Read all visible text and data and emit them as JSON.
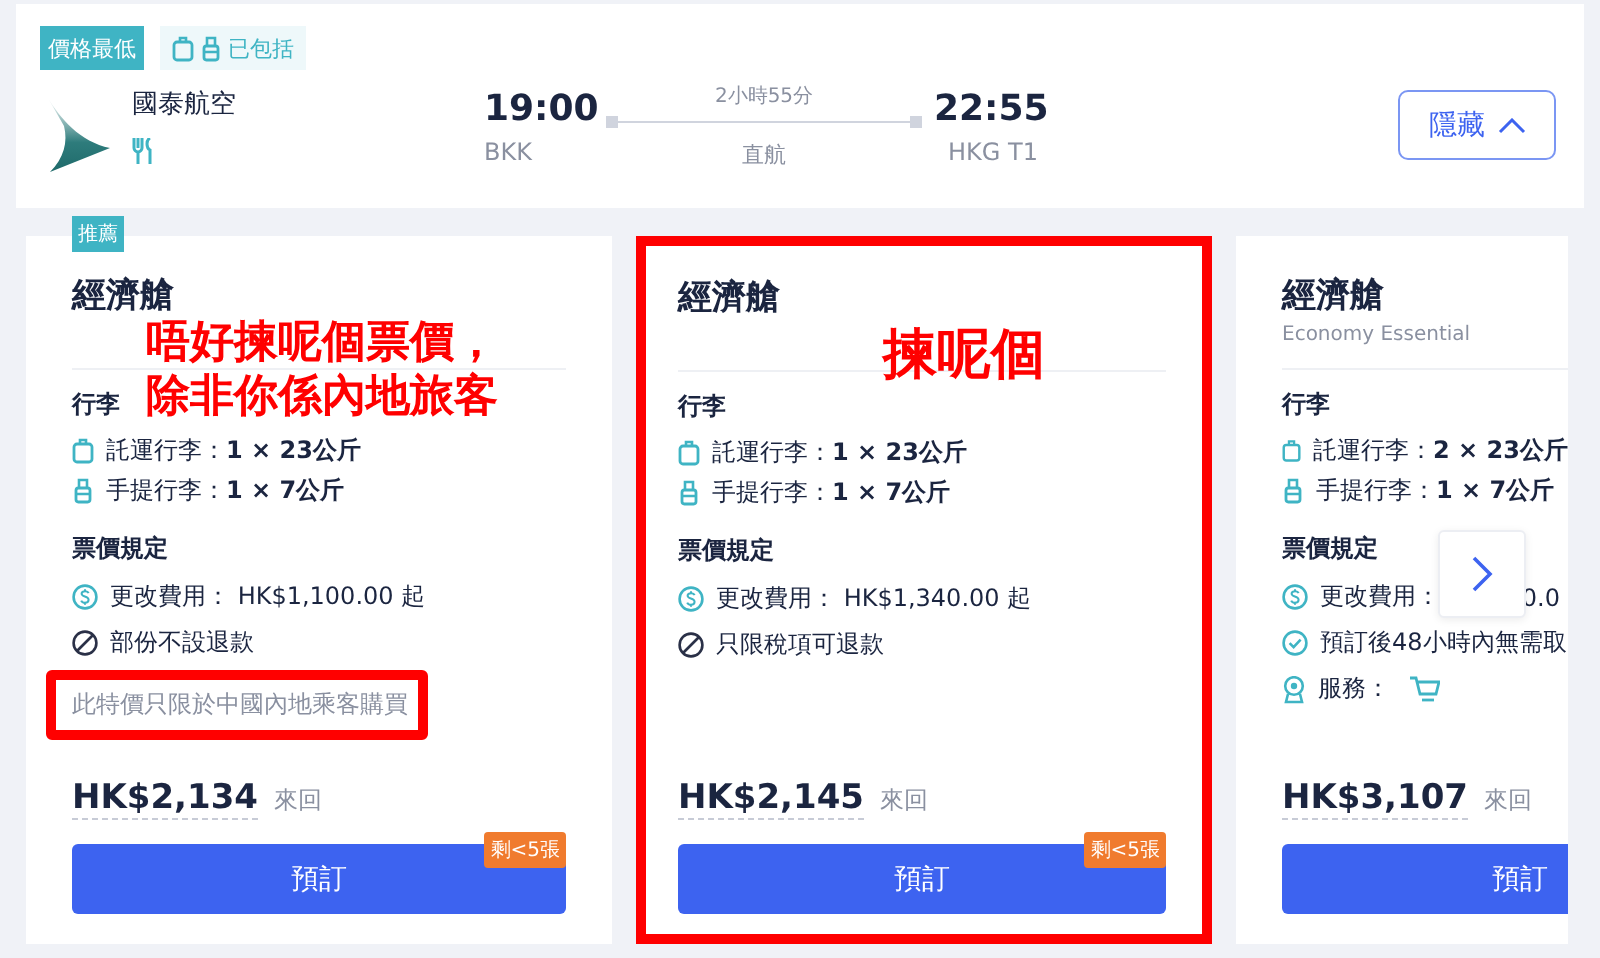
{
  "flight": {
    "badges": [
      {
        "kind": "best",
        "text": "價格最低"
      },
      {
        "kind": "baggage",
        "text": "已包括"
      }
    ],
    "airline": "國泰航空",
    "depart": {
      "time": "19:00",
      "airport": "BKK"
    },
    "duration": "2小時55分",
    "stops": "直航",
    "arrive": {
      "time": "22:55",
      "airport": "HKG T1"
    },
    "toggle": "隱藏"
  },
  "fares": [
    {
      "tag": "推薦",
      "title": "經濟艙",
      "boxed": false,
      "annotation": [
        "唔好揀呢個票價，",
        "除非你係內地旅客"
      ],
      "baggage_title": "行李",
      "baggage": [
        {
          "kind": "checked",
          "label": "託運行李：",
          "value": "1 × 23公斤"
        },
        {
          "kind": "cabin",
          "label": "手提行李：",
          "value": "1 × 7公斤"
        }
      ],
      "rules_title": "票價規定",
      "rules": [
        {
          "kind": "fee",
          "text": "更改費用： HK$1,100.00 起"
        },
        {
          "kind": "refund",
          "text": "部份不設退款"
        }
      ],
      "note": {
        "text": "此特價只限於中國內地乘客購買",
        "highlighted": true
      },
      "price": "HK$2,134",
      "trip": "來回",
      "book": "預訂",
      "seats": "剩<5張"
    },
    {
      "title": "經濟艙",
      "boxed": true,
      "annotation": [
        "揀呢個"
      ],
      "baggage_title": "行李",
      "baggage": [
        {
          "kind": "checked",
          "label": "託運行李：",
          "value": "1 × 23公斤"
        },
        {
          "kind": "cabin",
          "label": "手提行李：",
          "value": "1 × 7公斤"
        }
      ],
      "rules_title": "票價規定",
      "rules": [
        {
          "kind": "fee",
          "text": "更改費用： HK$1,340.00 起"
        },
        {
          "kind": "refund",
          "text": "只限稅項可退款"
        }
      ],
      "price": "HK$2,145",
      "trip": "來回",
      "book": "預訂",
      "seats": "剩<5張"
    },
    {
      "title": "經濟艙",
      "subtitle": "Economy Essential",
      "boxed": false,
      "baggage_title": "行李",
      "baggage": [
        {
          "kind": "checked",
          "label": "託運行李：",
          "value": "2 × 23公斤"
        },
        {
          "kind": "cabin",
          "label": "手提行李：",
          "value": "1 × 7公斤"
        }
      ],
      "rules_title": "票價規定",
      "rules": [
        {
          "kind": "fee",
          "text": "更改費用：",
          "tail": "0.0"
        },
        {
          "kind": "cancel",
          "text": "預訂後48小時內無需取"
        },
        {
          "kind": "service",
          "text": "服務："
        }
      ],
      "price": "HK$3,107",
      "trip": "來回",
      "book": "預訂"
    }
  ]
}
